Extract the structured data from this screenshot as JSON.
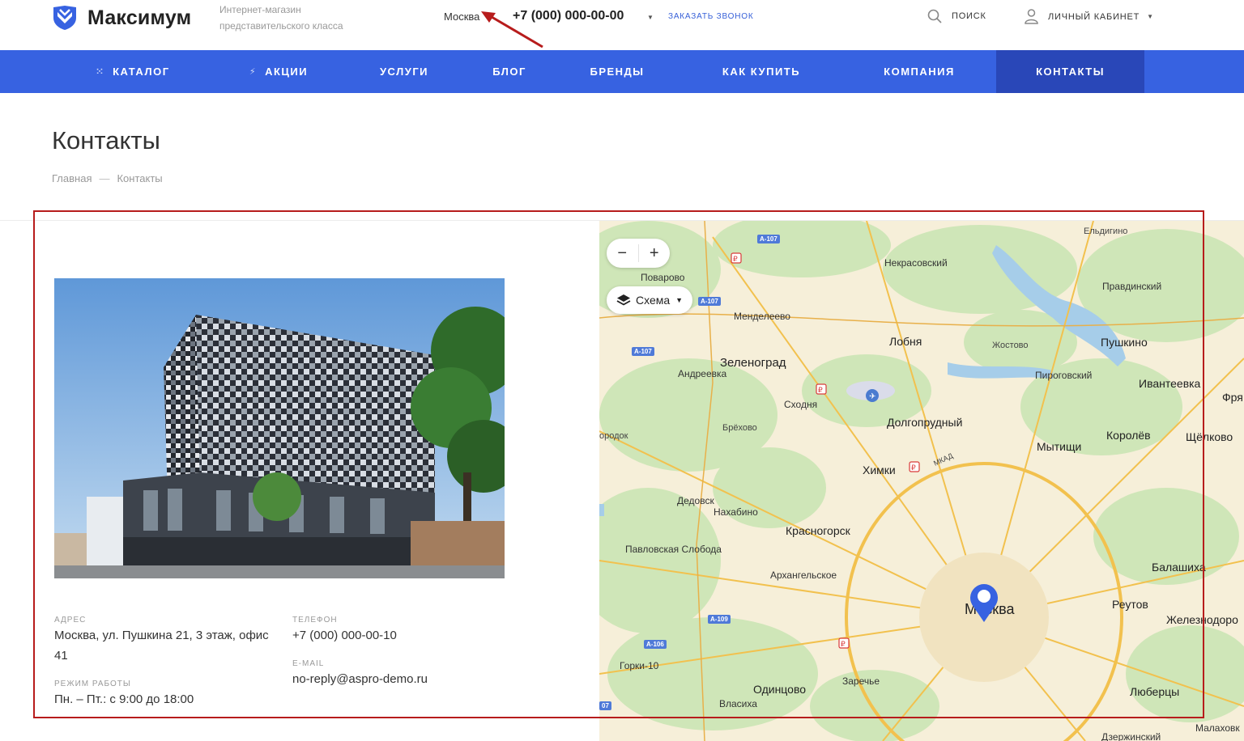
{
  "header": {
    "logo_text": "Максимум",
    "tagline": "Интернет-магазин представительского класса",
    "city": "Москва",
    "phone": "+7 (000) 000-00-00",
    "callback_label": "ЗАКАЗАТЬ ЗВОНОК",
    "search_label": "ПОИСК",
    "account_label": "ЛИЧНЫЙ КАБИНЕТ"
  },
  "nav": {
    "items": [
      {
        "label": "КАТАЛОГ",
        "icon": "grid-icon"
      },
      {
        "label": "АКЦИИ",
        "icon": "lightning-icon"
      },
      {
        "label": "УСЛУГИ"
      },
      {
        "label": "БЛОГ"
      },
      {
        "label": "БРЕНДЫ"
      },
      {
        "label": "КАК КУПИТЬ"
      },
      {
        "label": "КОМПАНИЯ"
      },
      {
        "label": "КОНТАКТЫ",
        "active": true
      }
    ]
  },
  "page": {
    "title": "Контакты",
    "breadcrumb": [
      "Главная",
      "—",
      "Контакты"
    ]
  },
  "contacts": {
    "address_label": "АДРЕС",
    "address_value": "Москва, ул. Пушкина 21, 3 этаж, офис 41",
    "hours_label": "РЕЖИМ РАБОТЫ",
    "hours_value": "Пн. – Пт.: с 9:00 до 18:00",
    "phone_label": "ТЕЛЕФОН",
    "phone_value": "+7 (000) 000-00-10",
    "email_label": "E-MAIL",
    "email_value": "no-reply@aspro-demo.ru"
  },
  "map": {
    "zoom_out": "−",
    "zoom_in": "+",
    "layer_label": "Схема",
    "labels": [
      "Ельдигино",
      "Некрасовский",
      "Поварово",
      "Правдинский",
      "Менделеево",
      "Лобня",
      "Пушкино",
      "Жостово",
      "Зеленоград",
      "Андреевка",
      "Пироговский",
      "Ивантеевка",
      "Фря",
      "Сходня",
      "Долгопрудный",
      "Брёхово",
      "ородок",
      "Мытищи",
      "Королёв",
      "Щёлково",
      "Химки",
      "Дедовск",
      "Нахабино",
      "Красногорск",
      "Павловская Слобода",
      "Балашиха",
      "Архангельское",
      "Москва",
      "Реутов",
      "Железнодоро",
      "Горки-10",
      "Заречье",
      "Одинцово",
      "Люберцы",
      "Власиха",
      "Малаховк",
      "Дзержинский",
      "МКАД"
    ],
    "road_badges": [
      "A-107",
      "A-107",
      "A-107",
      "A-109",
      "A-106",
      "07"
    ]
  },
  "colors": {
    "brand": "#3762e1",
    "nav_active": "#2947b8",
    "annotation": "#b71c1c"
  }
}
